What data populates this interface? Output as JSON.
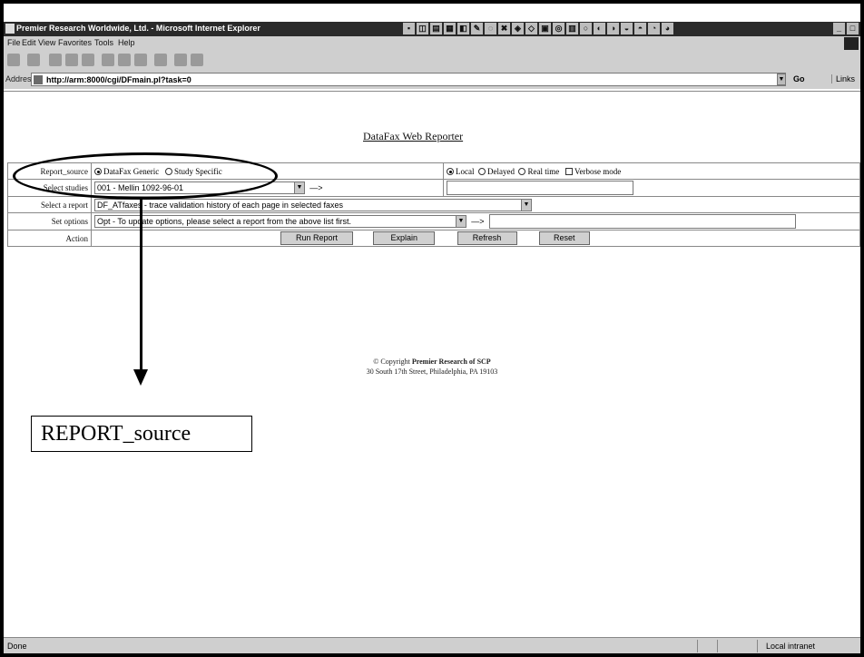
{
  "window": {
    "title": "Premier Research Worldwide, Ltd. - Microsoft Internet Explorer"
  },
  "menu": [
    "File",
    "Edit",
    "View",
    "Favorites",
    "Tools",
    "Help"
  ],
  "address": {
    "label": "Address",
    "url": "http://arm:8000/cgi/DFmain.pl?task=0",
    "go_label": "Go",
    "links_label": "Links"
  },
  "page": {
    "title": "DataFax Web Reporter",
    "rows": {
      "report_source": {
        "label": "Report_source",
        "option1": "DataFax Generic",
        "option2": "Study Specific",
        "mode1": "Local",
        "mode2": "Delayed",
        "mode3": "Real time",
        "verbose": "Verbose mode"
      },
      "select_studies": {
        "label": "Select studies",
        "value": "001 - Mellin 1092-96-01",
        "arrow": "—>"
      },
      "select_report": {
        "label": "Select a report",
        "value": "DF_ATfaxes     - trace validation history of each page in selected faxes"
      },
      "set_options": {
        "label": "Set options",
        "value": "Opt - To update options, please select a report from the above list first.",
        "arrow": "—>"
      },
      "action": {
        "label": "Action",
        "run": "Run Report",
        "explain": "Explain",
        "refresh": "Refresh",
        "reset": "Reset"
      }
    },
    "copyright_prefix": "© Copyright ",
    "copyright_org": "Premier Research of SCP",
    "address_line": "30 South 17th Street, Philadelphia, PA 19103"
  },
  "status": {
    "left": "Done",
    "zone": "Local intranet"
  },
  "annotation": {
    "callout": "REPORT_source"
  }
}
